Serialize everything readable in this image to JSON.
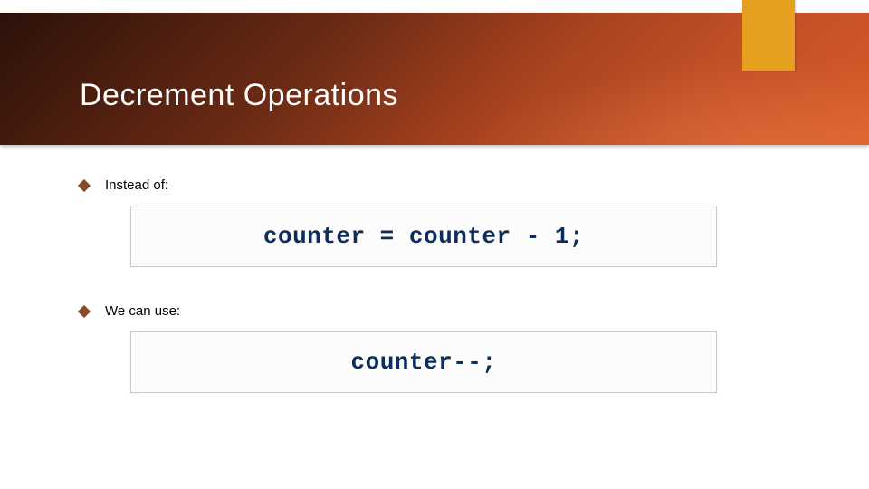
{
  "colors": {
    "accent_tab": "#e6a01f",
    "header_gradient_from": "#2b1109",
    "header_gradient_to": "#d55a28",
    "bullet_diamond": "#8a4a2c",
    "code_text": "#0b2e5d"
  },
  "title": "Decrement Operations",
  "bullets": [
    {
      "label": "Instead of:",
      "code": "counter = counter - 1;"
    },
    {
      "label": "We can use:",
      "code": "counter--;"
    }
  ]
}
